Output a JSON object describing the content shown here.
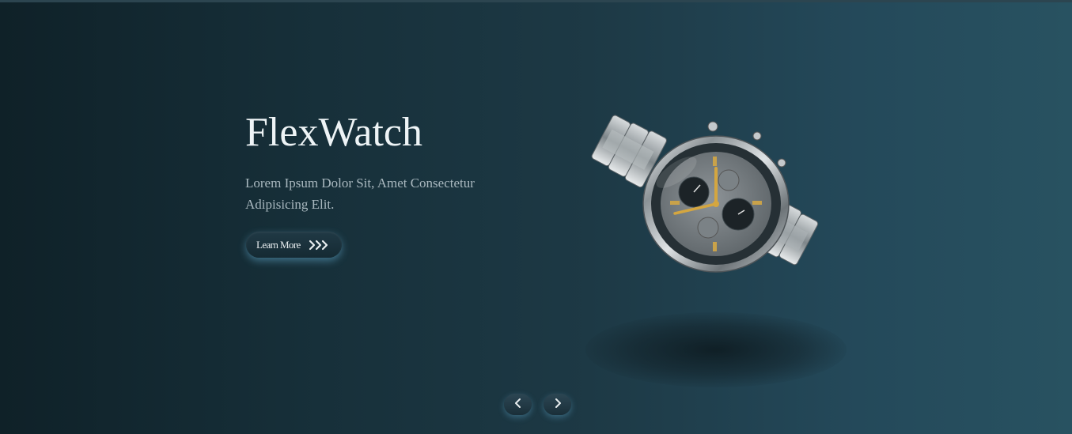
{
  "hero": {
    "title": "FlexWatch",
    "subtitle": "Lorem Ipsum Dolor Sit, Amet Consectetur Adipisicing Elit.",
    "cta_label": "Learn More",
    "cta_icon": "triple-chevron-right-icon",
    "product_image": "chronograph-wristwatch"
  },
  "slider": {
    "prev_icon": "chevron-left-icon",
    "next_icon": "chevron-right-icon"
  },
  "colors": {
    "background_start": "#0f2128",
    "background_end": "#285261",
    "title": "#eef4f6",
    "subtitle": "#a9b8bf",
    "button_glow": "#6ebee6"
  }
}
